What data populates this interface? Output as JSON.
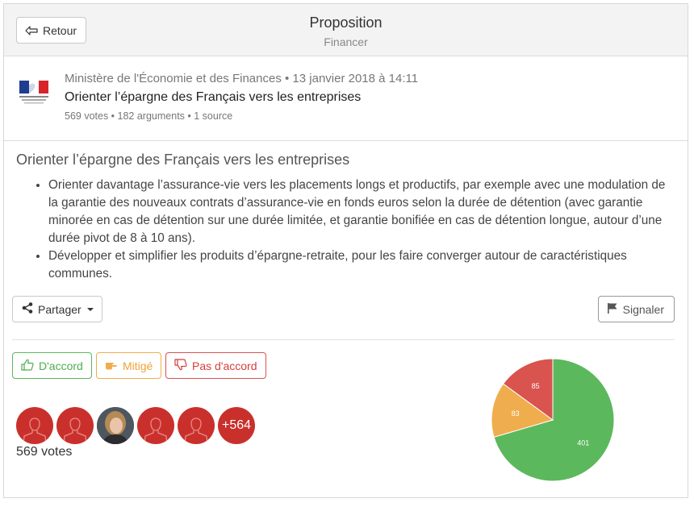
{
  "header": {
    "back_label": "Retour",
    "title": "Proposition",
    "subtitle": "Financer"
  },
  "author": {
    "meta": "Ministère de l'Économie et des Finances • 13 janvier 2018 à 14:11",
    "headline": "Orienter l’épargne des Français vers les entreprises",
    "stats": "569 votes • 182 arguments • 1 source",
    "logo_icon": "marianne-logo-icon"
  },
  "proposal": {
    "title": "Orienter l’épargne des Français vers les entreprises",
    "bullets": [
      "Orienter davantage l’assurance-vie vers les placements longs et productifs, par exemple avec une modulation de la garantie des nouveaux contrats d’assurance-vie en fonds euros selon la durée de détention (avec garantie minorée en cas de détention sur une durée limitée, et garantie bonifiée en cas de détention longue, autour d’une durée pivot de 8 à 10 ans).",
      "Développer et simplifier les produits d’épargne-retraite, pour les faire converger autour de caractéristiques communes."
    ]
  },
  "actions": {
    "share_label": "Partager",
    "report_label": "Signaler"
  },
  "votes": {
    "agree_label": "D'accord",
    "mixed_label": "Mitigé",
    "disagree_label": "Pas d'accord",
    "more_count": "+564",
    "total_label": "569 votes",
    "colors": {
      "agree": "#5cb85c",
      "mixed": "#f0ad4e",
      "disagree": "#d9534f"
    }
  },
  "chart_data": {
    "type": "pie",
    "title": "",
    "slices": [
      {
        "label": "D'accord",
        "value": 401,
        "color": "#5cb85c"
      },
      {
        "label": "Mitigé",
        "value": 83,
        "color": "#f0ad4e"
      },
      {
        "label": "Pas d'accord",
        "value": 85,
        "color": "#d9534f"
      }
    ]
  }
}
